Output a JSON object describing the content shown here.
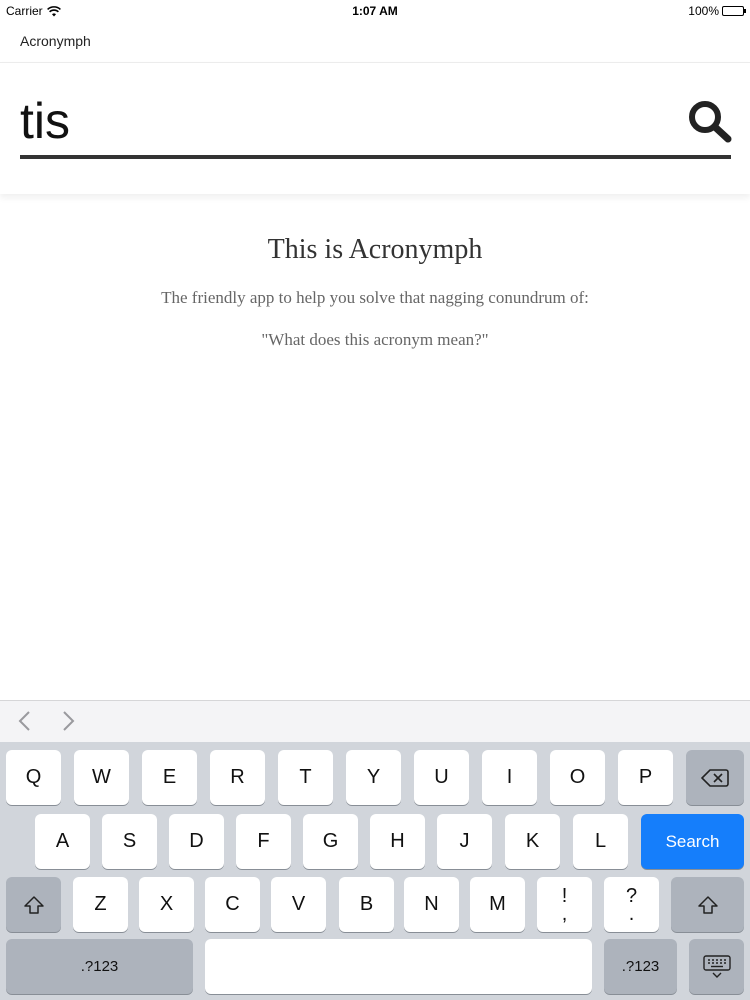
{
  "status": {
    "carrier": "Carrier",
    "time": "1:07 AM",
    "battery": "100%"
  },
  "app": {
    "title": "Acronymph"
  },
  "search": {
    "value": "tis",
    "placeholder": ""
  },
  "intro": {
    "heading": "This is Acronymph",
    "text": "The friendly app to help you solve that nagging conundrum of:",
    "quote": "\"What does this acronym mean?\""
  },
  "keyboard": {
    "row1": [
      "Q",
      "W",
      "E",
      "R",
      "T",
      "Y",
      "U",
      "I",
      "O",
      "P"
    ],
    "row2": [
      "A",
      "S",
      "D",
      "F",
      "G",
      "H",
      "J",
      "K",
      "L"
    ],
    "row3": [
      "Z",
      "X",
      "C",
      "V",
      "B",
      "N",
      "M"
    ],
    "punct1": {
      "top": "!",
      "bottom": ","
    },
    "punct2": {
      "top": "?",
      "bottom": "."
    },
    "search_label": "Search",
    "numbers_label": ".?123"
  },
  "colors": {
    "accent": "#157efb",
    "keyboard_bg": "#d1d5db",
    "underline": "#333333"
  }
}
